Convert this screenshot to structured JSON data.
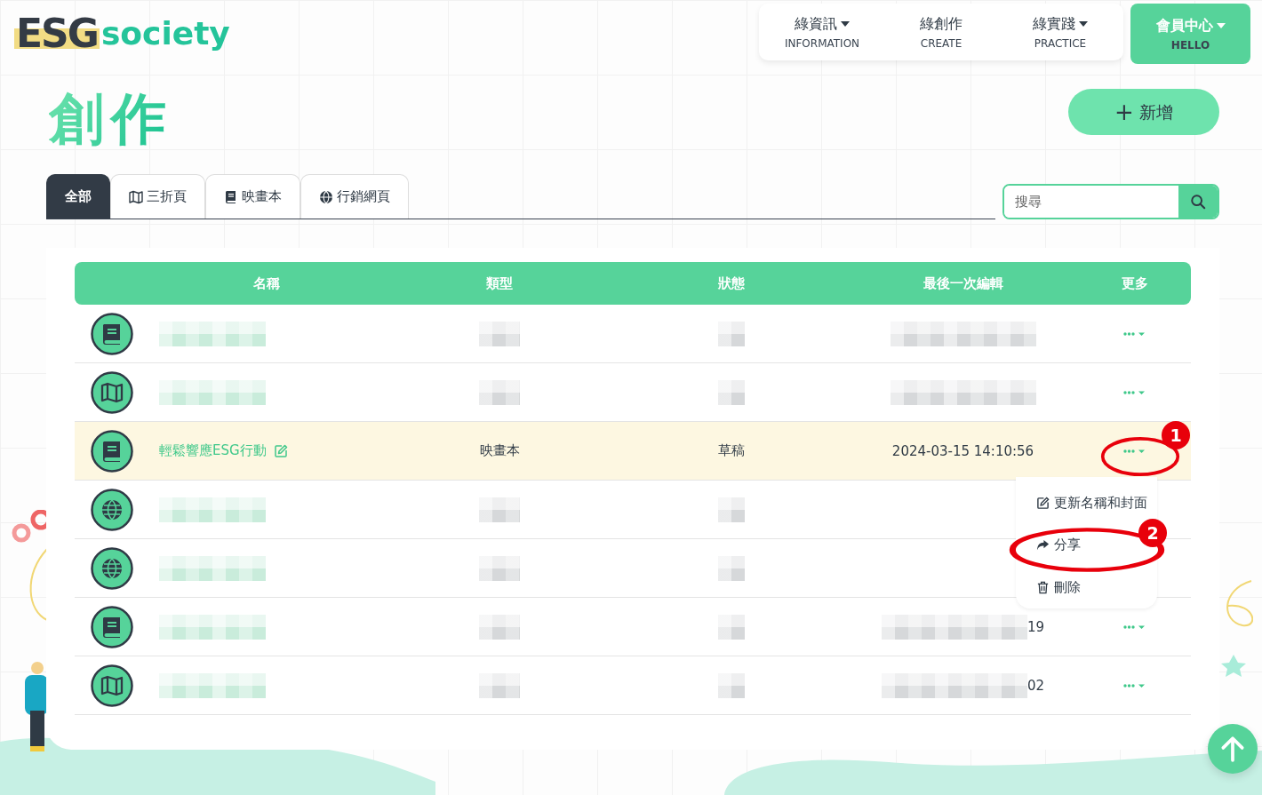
{
  "logo": {
    "mark": "ESG",
    "word": "society"
  },
  "nav": [
    {
      "label": "綠資訊",
      "sub": "INFORMATION",
      "dropdown": true
    },
    {
      "label": "綠創作",
      "sub": "CREATE",
      "dropdown": false
    },
    {
      "label": "綠實踐",
      "sub": "PRACTICE",
      "dropdown": true
    }
  ],
  "member": {
    "label": "會員中心",
    "sub": "HELLO",
    "dropdown": true
  },
  "title": "創作",
  "add_button": {
    "icon": "+",
    "label": "新增"
  },
  "tabs": [
    {
      "label": "全部",
      "selected": true
    },
    {
      "label": "三折頁",
      "selected": false
    },
    {
      "label": "映畫本",
      "selected": false
    },
    {
      "label": "行銷網頁",
      "selected": false
    }
  ],
  "search": {
    "placeholder": "搜尋"
  },
  "table": {
    "columns": [
      "名稱",
      "類型",
      "狀態",
      "最後一次編輯",
      "更多"
    ],
    "rows": [
      {
        "kind": "book",
        "redacted": true,
        "highlighted": false
      },
      {
        "kind": "map",
        "redacted": true,
        "highlighted": false
      },
      {
        "kind": "book",
        "redacted": false,
        "highlighted": true,
        "name": "輕鬆響應ESG行動",
        "type": "映畫本",
        "status": "草稿",
        "last_edit": "2024-03-15 14:10:56"
      },
      {
        "kind": "globe",
        "redacted": true,
        "highlighted": false
      },
      {
        "kind": "globe",
        "redacted": true,
        "highlighted": false
      },
      {
        "kind": "book",
        "redacted": true,
        "highlighted": false,
        "last_edit": "19"
      },
      {
        "kind": "map",
        "redacted": true,
        "highlighted": false,
        "last_edit": "02"
      }
    ]
  },
  "more_menu": {
    "items": [
      {
        "label": "更新名稱和封面"
      },
      {
        "label": "分享"
      },
      {
        "label": "刪除"
      }
    ]
  },
  "annotations": [
    {
      "label": "1"
    },
    {
      "label": "2"
    }
  ]
}
